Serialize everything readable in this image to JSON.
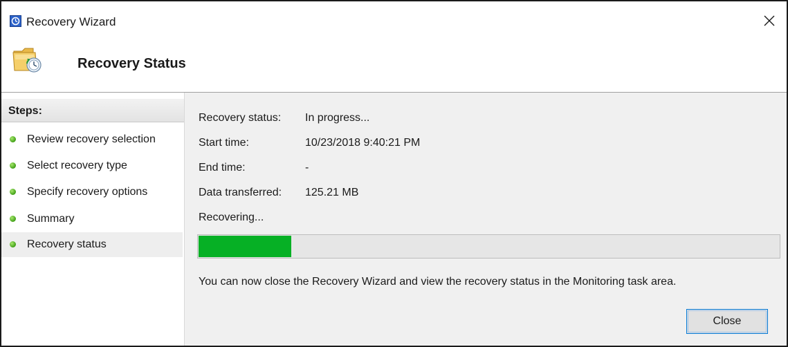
{
  "window": {
    "title": "Recovery Wizard",
    "close_glyph": "✕"
  },
  "header": {
    "title": "Recovery Status",
    "icon": "folder-recovery-icon"
  },
  "sidebar": {
    "heading": "Steps:",
    "items": [
      {
        "label": "Review recovery selection",
        "status": "complete"
      },
      {
        "label": "Select recovery type",
        "status": "complete"
      },
      {
        "label": "Specify recovery options",
        "status": "complete"
      },
      {
        "label": "Summary",
        "status": "complete"
      },
      {
        "label": "Recovery status",
        "status": "current"
      }
    ]
  },
  "status": {
    "recovery_status_label": "Recovery status:",
    "recovery_status_value": "In progress...",
    "start_time_label": "Start time:",
    "start_time_value": "10/23/2018 9:40:21 PM",
    "end_time_label": "End time:",
    "end_time_value": "-",
    "data_transferred_label": "Data transferred:",
    "data_transferred_value": "125.21 MB",
    "recovering_text": "Recovering...",
    "progress_fraction": 0.16,
    "info_text": "You can now close the Recovery Wizard and view the recovery status in the Monitoring task area."
  },
  "buttons": {
    "close_label": "Close"
  },
  "colors": {
    "progress_fill": "#06b025",
    "step_dot": "#3f9f16",
    "accent_border": "#0078d7"
  }
}
